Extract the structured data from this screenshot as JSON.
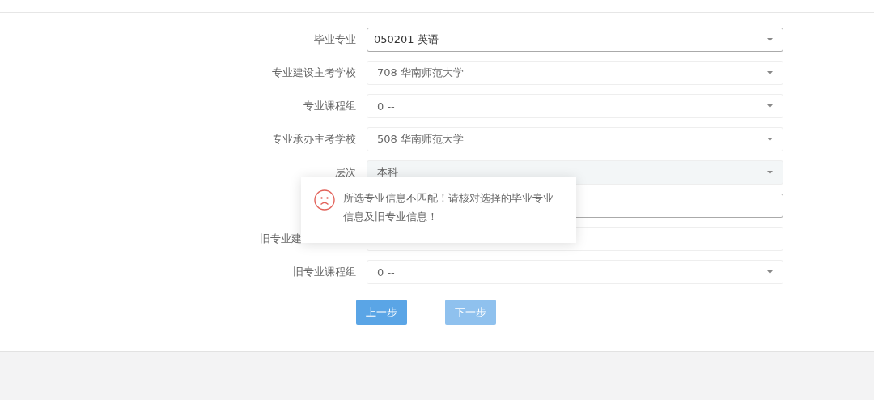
{
  "form": {
    "rows": [
      {
        "label": "毕业专业",
        "value": "050201 英语",
        "disabled": false,
        "highlighted": true
      },
      {
        "label": "专业建设主考学校",
        "value": "708 华南师范大学",
        "disabled": false,
        "highlighted": false
      },
      {
        "label": "专业课程组",
        "value": "0 --",
        "disabled": false,
        "highlighted": false
      },
      {
        "label": "专业承办主考学校",
        "value": "508 华南师范大学",
        "disabled": false,
        "highlighted": false
      },
      {
        "label": "层次",
        "value": "本科",
        "disabled": true,
        "highlighted": false
      },
      {
        "disabled": false,
        "highlighted": true
      },
      {
        "label": "旧专业建",
        "label_cut": true,
        "disabled": false,
        "highlighted": false
      },
      {
        "label": "旧专业课程组",
        "value": "0 --",
        "disabled": false,
        "highlighted": false
      }
    ],
    "buttons": [
      {
        "label": "上一步",
        "disabled": false
      },
      {
        "label": "下一步",
        "disabled": true
      }
    ]
  },
  "toast": {
    "message": "所选专业信息不匹配！请核对选择的毕业专业信息及旧专业信息！"
  }
}
